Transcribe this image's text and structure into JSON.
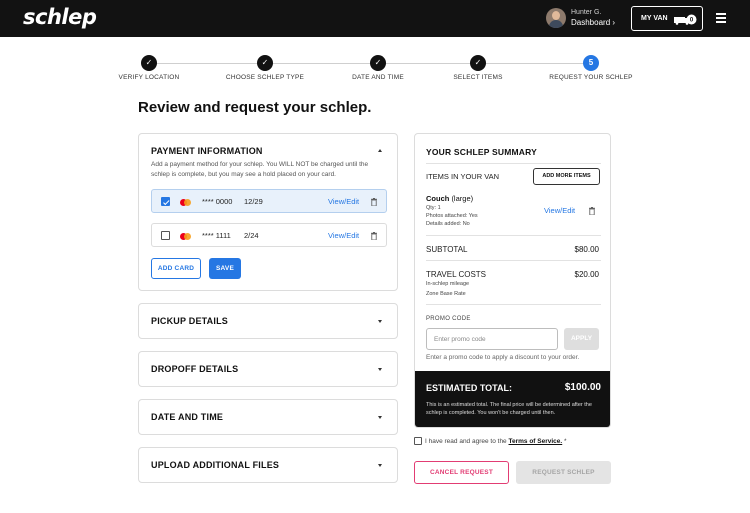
{
  "header": {
    "logo": "schlep",
    "user_name": "Hunter G.",
    "dashboard_label": "Dashboard",
    "van_label": "MY VAN",
    "van_count": "0"
  },
  "steps": [
    {
      "label": "VERIFY LOCATION",
      "status": "done"
    },
    {
      "label": "CHOOSE SCHLEP TYPE",
      "status": "done"
    },
    {
      "label": "DATE AND  TIME",
      "status": "done"
    },
    {
      "label": "SELECT ITEMS",
      "status": "done"
    },
    {
      "label": "REQUEST YOUR SCHLEP",
      "status": "active",
      "number": "5"
    }
  ],
  "page_title": "Review and request your schlep.",
  "payment": {
    "title": "PAYMENT INFORMATION",
    "description": "Add a payment method for your schlep. You WILL NOT be charged until the schlep is complete, but you may see a hold placed on your card.",
    "cards": [
      {
        "number": "**** 0000",
        "expiry": "12/29",
        "edit": "View/Edit",
        "selected": true
      },
      {
        "number": "**** 1111",
        "expiry": "2/24",
        "edit": "View/Edit",
        "selected": false
      }
    ],
    "add_card": "ADD CARD",
    "save": "SAVE"
  },
  "sections": [
    {
      "title": "PICKUP DETAILS"
    },
    {
      "title": "DROPOFF DETAILS"
    },
    {
      "title": "DATE AND TIME"
    },
    {
      "title": "UPLOAD ADDITIONAL FILES"
    }
  ],
  "summary": {
    "title": "YOUR SCHLEP SUMMARY",
    "items_label": "ITEMS IN YOUR VAN",
    "add_more": "ADD MORE ITEMS",
    "item": {
      "name": "Couch",
      "size": "(large)",
      "qty": "Qty: 1",
      "photos": "Photos attached: Yes",
      "details": "Details added: No",
      "edit": "View/Edit"
    },
    "subtotal_label": "SUBTOTAL",
    "subtotal": "$80.00",
    "travel_label": "TRAVEL COSTS",
    "travel": "$20.00",
    "travel_sub1": "In-schlep mileage",
    "travel_sub2": "Zone Base Rate",
    "promo_label": "PROMO CODE",
    "promo_placeholder": "Enter promo code",
    "apply": "APPLY",
    "promo_help": "Enter a promo code to apply a discount to your order.",
    "estimated_label": "ESTIMATED TOTAL:",
    "estimated_total": "$100.00",
    "estimated_note": "This is an estimated total. The final price will be determined after the schlep is completed. You won't be charged until then."
  },
  "terms": {
    "prefix": "I have read and agree to the",
    "link": "Terms of Service.",
    "suffix": "*"
  },
  "actions": {
    "cancel": "CANCEL REQUEST",
    "request": "REQUEST SCHLEP"
  },
  "colors": {
    "accent": "#2577e3",
    "cancel": "#e23c73",
    "header": "#121212"
  }
}
